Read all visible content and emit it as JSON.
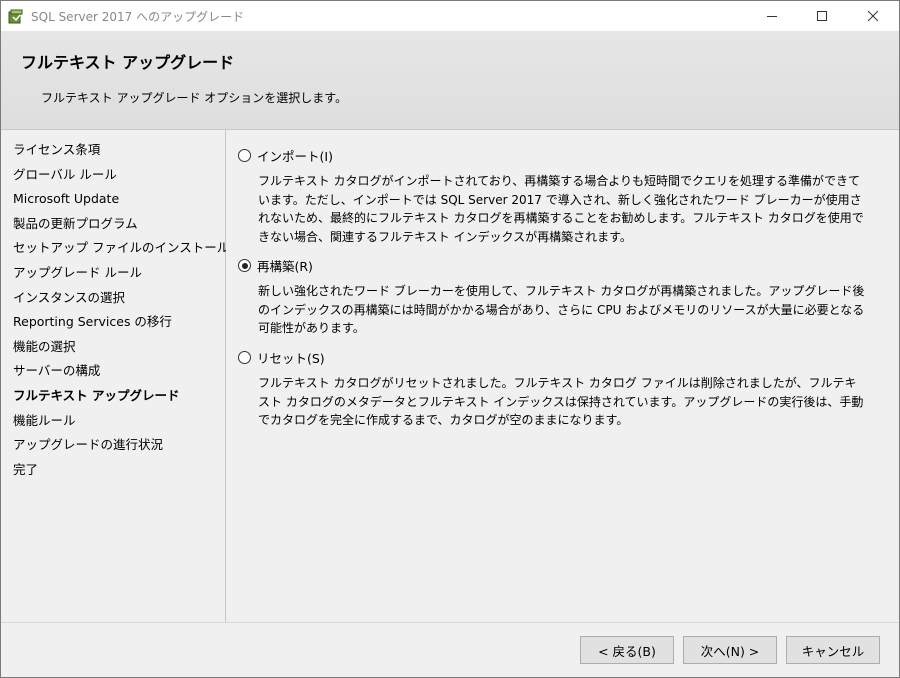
{
  "window": {
    "title": "SQL Server 2017 へのアップグレード"
  },
  "header": {
    "title": "フルテキスト アップグレード",
    "subtitle": "フルテキスト アップグレード オプションを選択します。"
  },
  "nav": {
    "items": [
      {
        "label": "ライセンス条項"
      },
      {
        "label": "グローバル ルール"
      },
      {
        "label": "Microsoft Update"
      },
      {
        "label": "製品の更新プログラム"
      },
      {
        "label": "セットアップ ファイルのインストール"
      },
      {
        "label": "アップグレード ルール"
      },
      {
        "label": "インスタンスの選択"
      },
      {
        "label": "Reporting Services の移行"
      },
      {
        "label": "機能の選択"
      },
      {
        "label": "サーバーの構成"
      },
      {
        "label": "フルテキスト アップグレード"
      },
      {
        "label": "機能ルール"
      },
      {
        "label": "アップグレードの進行状況"
      },
      {
        "label": "完了"
      }
    ],
    "active_index": 10
  },
  "options": [
    {
      "label": "インポート(I)",
      "selected": false,
      "description": "フルテキスト カタログがインポートされており、再構築する場合よりも短時間でクエリを処理する準備ができています。ただし、インポートでは SQL Server 2017 で導入され、新しく強化されたワード ブレーカーが使用されないため、最終的にフルテキスト カタログを再構築することをお勧めします。フルテキスト カタログを使用できない場合、関連するフルテキスト インデックスが再構築されます。"
    },
    {
      "label": "再構築(R)",
      "selected": true,
      "description": "新しい強化されたワード ブレーカーを使用して、フルテキスト カタログが再構築されました。アップグレード後のインデックスの再構築には時間がかかる場合があり、さらに CPU およびメモリのリソースが大量に必要となる可能性があります。"
    },
    {
      "label": "リセット(S)",
      "selected": false,
      "description": "フルテキスト カタログがリセットされました。フルテキスト カタログ ファイルは削除されましたが、フルテキスト カタログのメタデータとフルテキスト インデックスは保持されています。アップグレードの実行後は、手動でカタログを完全に作成するまで、カタログが空のままになります。"
    }
  ],
  "footer": {
    "back_label": "< 戻る(B)",
    "next_label": "次へ(N) >",
    "cancel_label": "キャンセル"
  },
  "icons": {
    "app": "setup-box-icon",
    "minimize": "minimize-icon",
    "maximize": "maximize-icon",
    "close": "close-icon"
  }
}
